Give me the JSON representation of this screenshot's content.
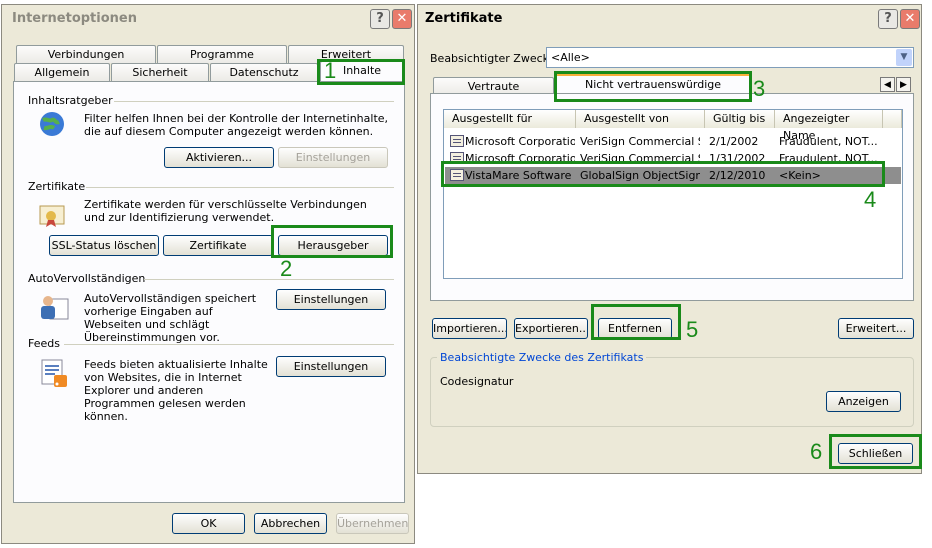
{
  "left_dialog": {
    "title": "Internetoptionen",
    "tabs_row1": [
      "Verbindungen",
      "Programme",
      "Erweitert"
    ],
    "tabs_row2": [
      "Allgemein",
      "Sicherheit",
      "Datenschutz",
      "Inhalte"
    ],
    "inhaltsratgeber": {
      "heading": "Inhaltsratgeber",
      "text": "Filter helfen Ihnen bei der Kontrolle der Internetinhalte, die auf diesem Computer angezeigt werden können.",
      "activate": "Aktivieren...",
      "settings": "Einstellungen"
    },
    "zertifikate": {
      "heading": "Zertifikate",
      "text": "Zertifikate werden für verschlüsselte Verbindungen und zur Identifizierung verwendet.",
      "ssl": "SSL-Status löschen",
      "certs": "Zertifikate",
      "publishers": "Herausgeber"
    },
    "autocomplete": {
      "heading": "AutoVervollständigen",
      "text": "AutoVervollständigen speichert vorherige Eingaben auf Webseiten und schlägt Übereinstimmungen vor.",
      "settings": "Einstellungen"
    },
    "feeds": {
      "heading": "Feeds",
      "text": "Feeds bieten aktualisierte Inhalte von Websites, die in Internet Explorer und anderen Programmen gelesen werden können.",
      "settings": "Einstellungen"
    },
    "ok": "OK",
    "cancel": "Abbrechen",
    "apply": "Übernehmen"
  },
  "right_dialog": {
    "title": "Zertifikate",
    "purpose_label": "Beabsichtigter Zweck:",
    "purpose_value": "<Alle>",
    "tab_trusted": "Vertraute Herausgeber",
    "tab_untrusted": "Nicht vertrauenswürdige Herausgeber",
    "columns": [
      "Ausgestellt für",
      "Ausgestellt von",
      "Gültig bis",
      "Angezeigter Name"
    ],
    "rows": [
      [
        "Microsoft Corporation",
        "VeriSign Commercial S...",
        "2/1/2002",
        "Fraudulent, NOT..."
      ],
      [
        "Microsoft Corporation",
        "VeriSign Commercial S...",
        "1/31/2002",
        "Fraudulent, NOT..."
      ],
      [
        "VistaMare Software",
        "GlobalSign ObjectSign...",
        "2/12/2010",
        "<Kein>"
      ]
    ],
    "import": "Importieren...",
    "export": "Exportieren...",
    "remove": "Entfernen",
    "advanced": "Erweitert...",
    "group_label": "Beabsichtigte Zwecke des Zertifikats",
    "group_value": "Codesignatur",
    "view": "Anzeigen",
    "close": "Schließen"
  },
  "annotations": [
    "1",
    "2",
    "3",
    "4",
    "5",
    "6"
  ],
  "colors": {
    "annotation": "#1a8a1a",
    "selection": "#8e8e8e",
    "dialog_bg": "#ece9d8",
    "close_button": "#e97b6b"
  }
}
